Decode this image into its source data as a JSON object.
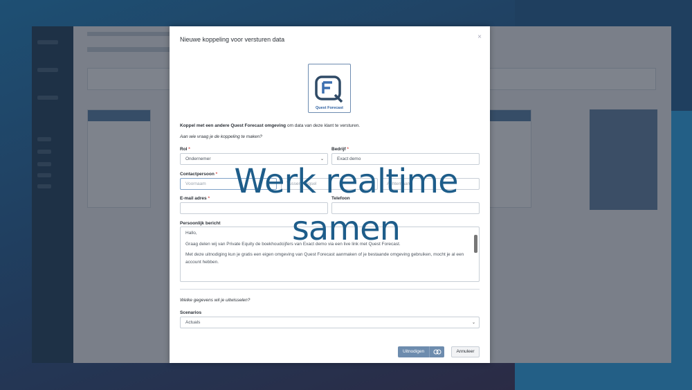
{
  "modal": {
    "title": "Nieuwe koppeling voor versturen data",
    "close": "×",
    "logo_caption": "Quest Forecast",
    "intro_bold": "Koppel met een andere Quest Forecast omgeving",
    "intro_rest": " om data van deze klant te versturen.",
    "question": "Aan wie vraag je de koppeling te maken?",
    "rol_label": "Rol",
    "rol_value": "Ondernemer",
    "bedrijf_label": "Bedrijf",
    "bedrijf_value": "Exact demo",
    "contact_label": "Contactpersoon",
    "voornaam_placeholder": "Voornaam",
    "tussenvoegsel_placeholder": "Tussenvoegsel",
    "achternaam_placeholder": "Achternaam",
    "email_label": "E-mail adres",
    "telefoon_label": "Telefoon",
    "bericht_label": "Persoonlijk bericht",
    "bericht_lines": [
      "Hallo,",
      "Graag delen wij van Private Equity de boekhoudcijfers van Exact demo via een live link met Quest Forecast.",
      "Met deze uitnodiging kun je gratis een eigen omgeving van Quest Forecast aanmaken of je bestaande omgeving gebruiken, mocht je al een account hebben."
    ],
    "uitwisselen_question": "Welke gegevens wil je uitwisselen?",
    "scenarios_label": "Scenarios",
    "scenarios_value": "Actuals",
    "invite_button": "Uitnodigen",
    "cancel_button": "Annuleer",
    "required_mark": "*"
  },
  "overlay_text": {
    "line1": "Werk realtime",
    "line2": "samen"
  },
  "icons": {
    "select": "chevron-down-icon",
    "close": "close-icon",
    "toggle": "toggle-icon"
  },
  "colors": {
    "primary_button": "#6d8cae",
    "headline": "#1e5d8a",
    "required": "#d9534f"
  }
}
